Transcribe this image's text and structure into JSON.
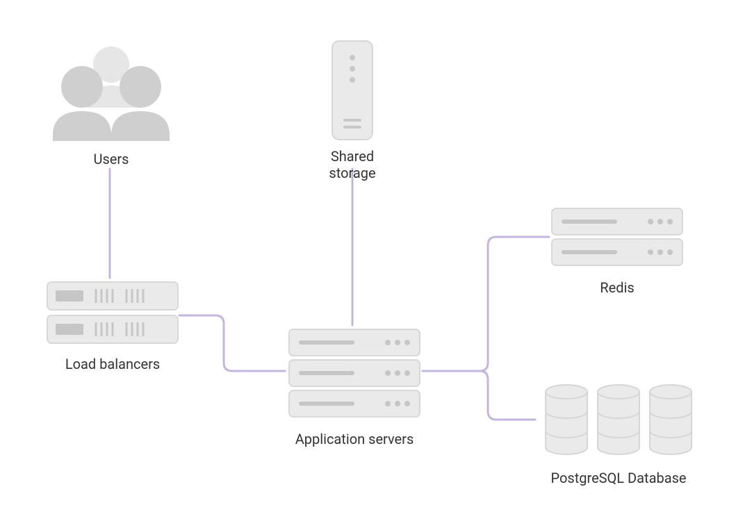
{
  "diagram": {
    "nodes": {
      "users": {
        "label": "Users"
      },
      "shared_storage": {
        "label": "Shared storage"
      },
      "load_balancers": {
        "label": "Load balancers"
      },
      "application_servers": {
        "label": "Application servers"
      },
      "redis": {
        "label": "Redis"
      },
      "postgresql": {
        "label": "PostgreSQL Database"
      }
    },
    "connections": [
      [
        "users",
        "load_balancers"
      ],
      [
        "shared_storage",
        "application_servers"
      ],
      [
        "load_balancers",
        "application_servers"
      ],
      [
        "application_servers",
        "redis"
      ],
      [
        "application_servers",
        "postgresql"
      ]
    ],
    "colors": {
      "connector": "#c4b5e0",
      "icon_light": "#e8e8e8",
      "icon_mid": "#d0d0d0",
      "icon_dark": "#b8b8b8"
    }
  }
}
